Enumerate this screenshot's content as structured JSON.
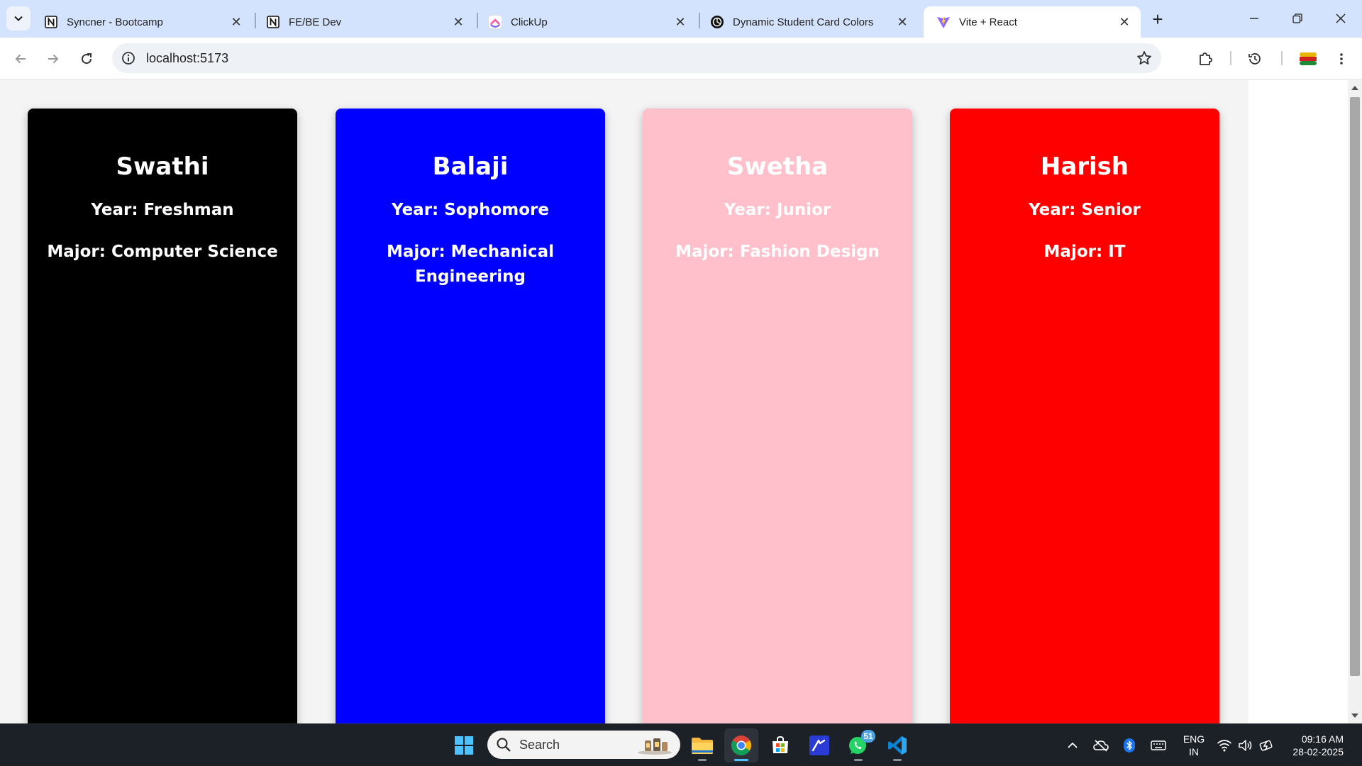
{
  "browser": {
    "tabs": [
      {
        "title": "Syncner - Bootcamp",
        "icon": "notion-icon",
        "active": false
      },
      {
        "title": "FE/BE Dev",
        "icon": "notion-icon",
        "active": false
      },
      {
        "title": "ClickUp",
        "icon": "clickup-icon",
        "active": false
      },
      {
        "title": "Dynamic Student Card Colors",
        "icon": "chatgpt-icon",
        "active": false
      },
      {
        "title": "Vite + React",
        "icon": "vite-icon",
        "active": true
      }
    ],
    "close_glyph": "✕",
    "new_tab_glyph": "+",
    "url": "localhost:5173"
  },
  "students": [
    {
      "name": "Swathi",
      "year_line": "Year: Freshman",
      "major_line": "Major: Computer Science",
      "color": "#000000",
      "text_color": "#ffffff"
    },
    {
      "name": "Balaji",
      "year_line": "Year: Sophomore",
      "major_line": "Major: Mechanical Engineering",
      "color": "#0000ff",
      "text_color": "#ffffff"
    },
    {
      "name": "Swetha",
      "year_line": "Year: Junior",
      "major_line": "Major: Fashion Design",
      "color": "#ffc0cb",
      "text_color": "#ffffff"
    },
    {
      "name": "Harish",
      "year_line": "Year: Senior",
      "major_line": "Major: IT",
      "color": "#ff0000",
      "text_color": "#ffffff"
    }
  ],
  "taskbar": {
    "search_label": "Search",
    "whatsapp_badge": "51",
    "lang_line1": "ENG",
    "lang_line2": "IN",
    "time": "09:16 AM",
    "date": "28-02-2025",
    "accent": "#4cc2ff"
  }
}
